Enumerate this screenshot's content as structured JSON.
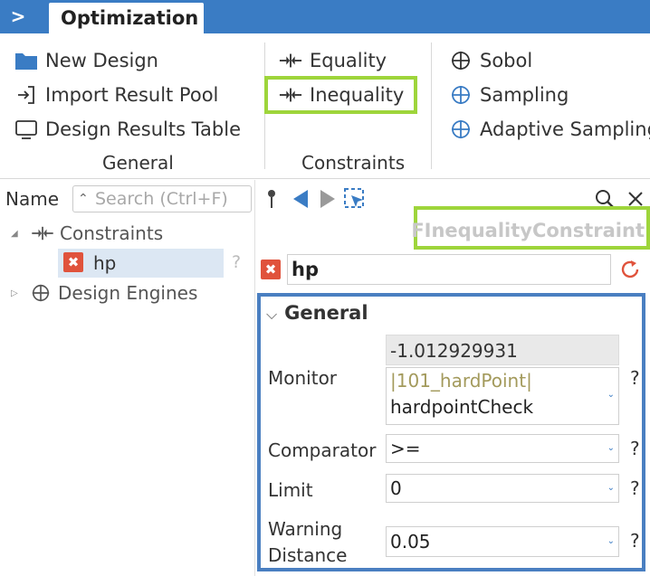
{
  "titlebar": {
    "tab_label": "Optimization",
    "toggle_glyph": ">"
  },
  "ribbon": {
    "general": {
      "label": "General",
      "new_design": "New Design",
      "import_result_pool": "Import Result Pool",
      "design_results_table": "Design Results Table"
    },
    "constraints": {
      "label": "Constraints",
      "equality": "Equality",
      "inequality": "Inequality"
    },
    "engines": {
      "sobol": "Sobol",
      "sampling": "Sampling",
      "adaptive_sampling": "Adaptive Sampling"
    }
  },
  "left_panel": {
    "name_label": "Name",
    "search_placeholder": "Search (Ctrl+F)",
    "tree": {
      "constraints": "Constraints",
      "hp": "hp",
      "hp_help": "?",
      "design_engines": "Design Engines"
    }
  },
  "right_panel": {
    "type_name": "FInequalityConstraint",
    "object_name": "hp",
    "section": "General",
    "monitor": {
      "label": "Monitor",
      "readonly_value": "-1.012929931",
      "line1": "|101_hardPoint|",
      "line2": "hardpointCheck"
    },
    "comparator": {
      "label": "Comparator",
      "value": ">="
    },
    "limit": {
      "label": "Limit",
      "value": "0"
    },
    "warning_distance": {
      "label_line1": "Warning",
      "label_line2": "Distance",
      "value": "0.05"
    },
    "help": "?"
  },
  "colors": {
    "accent": "#3a7cc4",
    "highlight_green": "#9ed53b",
    "highlight_blue": "#4a7fc1",
    "error_red": "#e0533c"
  }
}
